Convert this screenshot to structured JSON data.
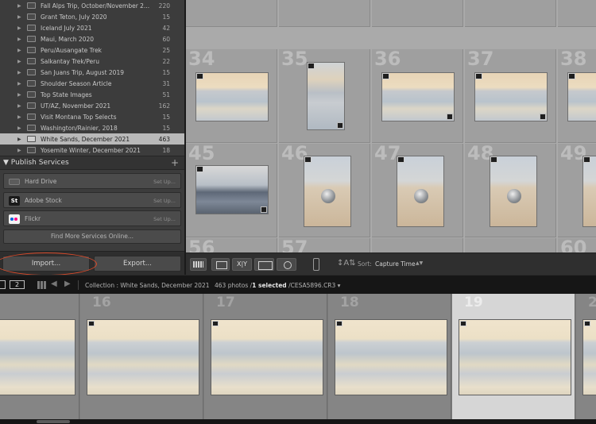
{
  "collections": [
    {
      "name": "Fall Alps Trip, October/November 2...",
      "count": "220"
    },
    {
      "name": "Grant Teton, July 2020",
      "count": "15"
    },
    {
      "name": "Iceland July 2021",
      "count": "42"
    },
    {
      "name": "Maui, March 2020",
      "count": "60"
    },
    {
      "name": "Peru/Ausangate Trek",
      "count": "25"
    },
    {
      "name": "Salkantay Trek/Peru",
      "count": "22"
    },
    {
      "name": "San Juans Trip, August 2019",
      "count": "15"
    },
    {
      "name": "Shoulder Season Article",
      "count": "31"
    },
    {
      "name": "Top State Images",
      "count": "51"
    },
    {
      "name": "UT/AZ, November 2021",
      "count": "162"
    },
    {
      "name": "Visit Montana Top Selects",
      "count": "15"
    },
    {
      "name": "Washington/Rainier, 2018",
      "count": "15"
    },
    {
      "name": "White Sands, December 2021",
      "count": "463"
    },
    {
      "name": "Yosemite Winter, December 2021",
      "count": "18"
    }
  ],
  "publish_services": {
    "title": "Publish Services",
    "plus": "+",
    "services": [
      {
        "name": "Hard Drive",
        "setup": "Set Up..."
      },
      {
        "name": "Adobe Stock",
        "icon_text": "St",
        "setup": "Set Up..."
      },
      {
        "name": "Flickr",
        "setup": "Set Up..."
      }
    ],
    "find_more": "Find More Services Online..."
  },
  "buttons": {
    "import": "Import...",
    "export": "Export..."
  },
  "grid": {
    "row1": [
      "",
      "",
      "",
      "",
      ""
    ],
    "row2": [
      "34",
      "35",
      "36",
      "37",
      "38"
    ],
    "row3": [
      "45",
      "46",
      "47",
      "48",
      "49"
    ],
    "row4": [
      "56",
      "57",
      "",
      "",
      "60"
    ]
  },
  "toolbar": {
    "compare_label": "X|Y",
    "sort_label": "Sort:",
    "sort_value": "Capture Time",
    "sort_chevron": "▲▼"
  },
  "filmstrip_bar": {
    "view_2": "2",
    "collection": "Collection : White Sands, December 2021",
    "photo_count": "463 photos /",
    "selected": "1 selected",
    "file": " /CESA5896.CR3 ▾"
  },
  "filmstrip": [
    "",
    "16",
    "17",
    "18",
    "19",
    "2"
  ],
  "colors": {
    "highlight_circle": "#d94a2a",
    "selected_row": "#b9b9b9"
  }
}
